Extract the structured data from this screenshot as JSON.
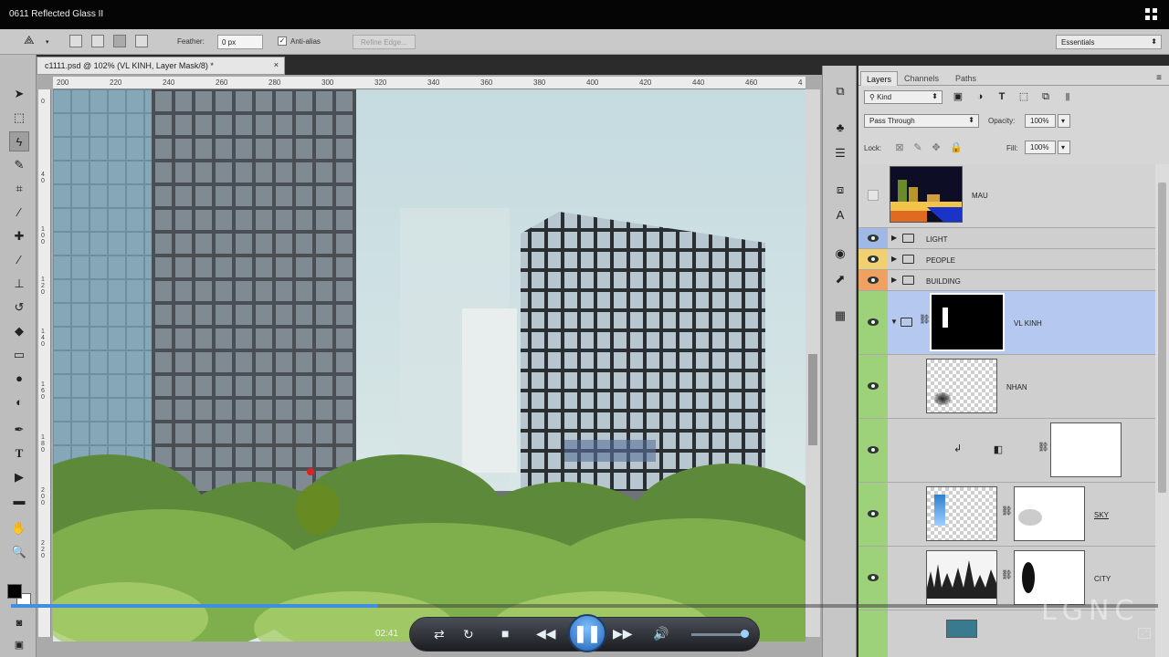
{
  "window": {
    "title": "0611 Reflected Glass II"
  },
  "options": {
    "feather_label": "Feather:",
    "feather_value": "0 px",
    "antialias_label": "Anti-alias",
    "refine_edge_label": "Refine Edge...",
    "workspace": "Essentials"
  },
  "document": {
    "tab_title": "c1111.psd @ 102% (VL KINH, Layer Mask/8) *",
    "close_glyph": "×",
    "ruler_h": [
      "200",
      "220",
      "240",
      "260",
      "280",
      "300",
      "320",
      "340",
      "360",
      "380",
      "400",
      "420",
      "440",
      "460",
      "4"
    ],
    "ruler_v": [
      "0",
      "4 0",
      "1 0 0",
      "1 2 0",
      "1 4 0",
      "1 6 0",
      "1 8 0",
      "2 0 0",
      "2 2 0"
    ]
  },
  "panel": {
    "tabs": [
      "Layers",
      "Channels",
      "Paths"
    ],
    "filter_kind": "Kind",
    "blend_mode": "Pass Through",
    "opacity_label": "Opacity:",
    "opacity_value": "100%",
    "lock_label": "Lock:",
    "fill_label": "Fill:",
    "fill_value": "100%"
  },
  "layers": [
    {
      "name": "MAU",
      "visible": false
    },
    {
      "name": "LIGHT",
      "visible": true,
      "color": "#9fb8e6"
    },
    {
      "name": "PEOPLE",
      "visible": true,
      "color": "#f0d070"
    },
    {
      "name": "BUILDING",
      "visible": true,
      "color": "#f0a060"
    },
    {
      "name": "VL KINH",
      "visible": true,
      "selected": true
    },
    {
      "name": "NHAN",
      "visible": true
    },
    {
      "name": "",
      "visible": true
    },
    {
      "name": "SKY",
      "visible": true
    },
    {
      "name": "CITY",
      "visible": true
    }
  ],
  "player": {
    "time": "02:41",
    "progress": 0.32,
    "volume": 0.9
  },
  "watermark": "LGNC",
  "colors": {
    "accent": "#3f8fe0",
    "selection": "#b4c8f0",
    "green_label": "#9ed27a"
  }
}
